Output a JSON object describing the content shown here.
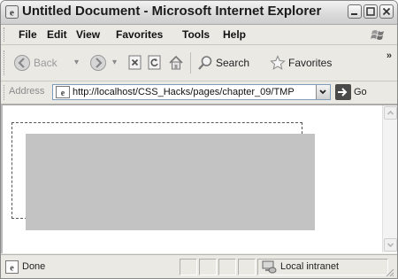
{
  "window": {
    "title": "Untitled Document - Microsoft Internet Explorer"
  },
  "menu": {
    "items": [
      "File",
      "Edit",
      "View",
      "Favorites",
      "Tools",
      "Help"
    ]
  },
  "toolbar": {
    "back_label": "Back",
    "search_label": "Search",
    "favorites_label": "Favorites",
    "overflow_label": "»"
  },
  "address": {
    "label": "Address",
    "url": "http://localhost/CSS_Hacks/pages/chapter_09/TMP",
    "go_label": "Go"
  },
  "status": {
    "text": "Done",
    "zone": "Local intranet"
  }
}
